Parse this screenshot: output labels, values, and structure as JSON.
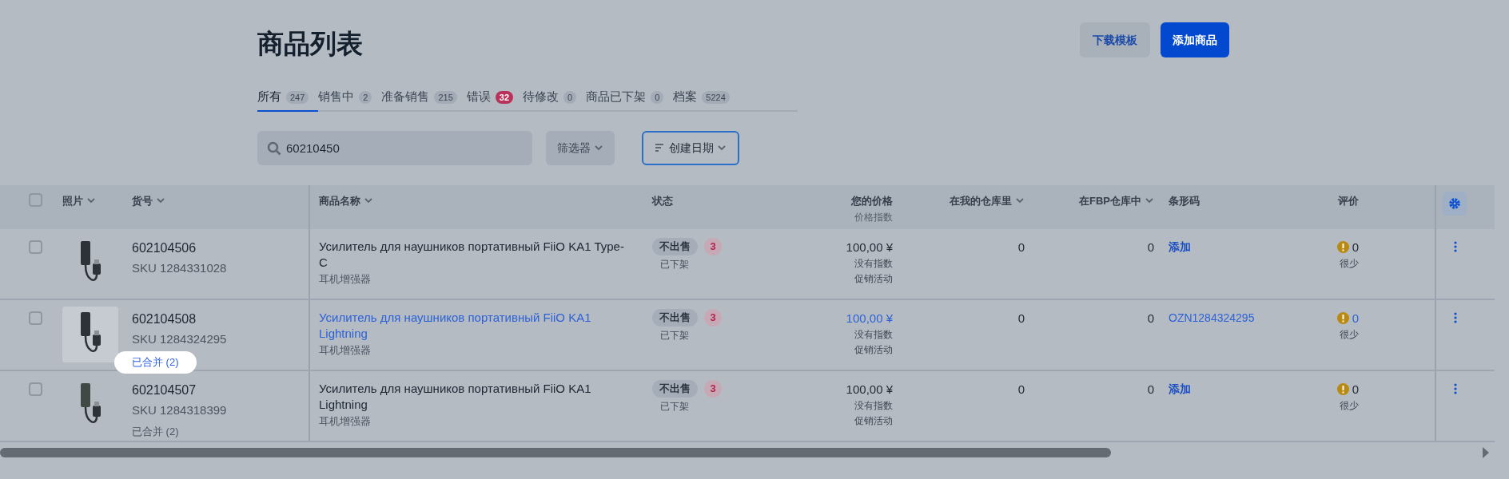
{
  "page": {
    "title": "商品列表"
  },
  "actions": [
    {
      "label": "下载模板",
      "kind": "secondary"
    },
    {
      "label": "添加商品",
      "kind": "primary"
    }
  ],
  "tabs": [
    {
      "label": "所有",
      "count": "247",
      "selected": true,
      "alert": false
    },
    {
      "label": "销售中",
      "count": "2",
      "selected": false,
      "alert": false
    },
    {
      "label": "准备销售",
      "count": "215",
      "selected": false,
      "alert": false
    },
    {
      "label": "错误",
      "count": "32",
      "selected": false,
      "alert": true
    },
    {
      "label": "待修改",
      "count": "0",
      "selected": false,
      "alert": false
    },
    {
      "label": "商品已下架",
      "count": "0",
      "selected": false,
      "alert": false
    },
    {
      "label": "档案",
      "count": "5224",
      "selected": false,
      "alert": false
    }
  ],
  "search": {
    "value": "60210450"
  },
  "filter": {
    "label": "筛选器"
  },
  "sort": {
    "label": "创建日期"
  },
  "table": {
    "all_checked": false,
    "columns": [
      {
        "label": "照片",
        "sortable": true
      },
      {
        "label": "货号",
        "sortable": true
      },
      {
        "label": "商品名称",
        "sortable": true
      },
      {
        "label": "状态",
        "sortable": false
      },
      {
        "label": "您的价格",
        "sub": "价格指数",
        "sortable": false
      },
      {
        "label": "在我的仓库里",
        "sortable": true
      },
      {
        "label": "在FBP仓库中",
        "sortable": true
      },
      {
        "label": "条形码",
        "sortable": false
      },
      {
        "label": "评价",
        "sortable": false
      }
    ],
    "rows": [
      {
        "checked": false,
        "photo_highlighted": false,
        "article": "602104506",
        "sku": "SKU 1284331028",
        "merged": null,
        "name": "Усилитель для наушников портативный FiiO KA1 Type-C",
        "name_link": false,
        "category": "耳机增强器",
        "status": "不出售",
        "errors": "3",
        "status_note": "已下架",
        "price": "100,00 ¥",
        "price_link": false,
        "price_index": "没有指数",
        "promo": "促销活动",
        "my_stock": "0",
        "fbp_stock": "0",
        "barcode": {
          "kind": "add",
          "text": "添加"
        },
        "rating": "0",
        "rating_link": false,
        "rating_note": "很少"
      },
      {
        "checked": false,
        "photo_highlighted": true,
        "article": "602104508",
        "sku": "SKU 1284324295",
        "merged": {
          "label": "已合并 (2)",
          "highlighted": true
        },
        "name": "Усилитель для наушников портативный FiiO KA1 Lightning",
        "name_link": true,
        "category": "耳机增强器",
        "status": "不出售",
        "errors": "3",
        "status_note": "已下架",
        "price": "100,00 ¥",
        "price_link": true,
        "price_index": "没有指数",
        "promo": "促销活动",
        "my_stock": "0",
        "fbp_stock": "0",
        "barcode": {
          "kind": "value",
          "text": "OZN1284324295"
        },
        "rating": "0",
        "rating_link": true,
        "rating_note": "很少"
      },
      {
        "checked": false,
        "photo_highlighted": false,
        "article": "602104507",
        "sku": "SKU 1284318399",
        "merged": {
          "label": "已合并 (2)",
          "highlighted": false
        },
        "name": "Усилитель для наушников портативный FiiO KA1 Lightning",
        "name_link": false,
        "category": "耳机增强器",
        "status": "不出售",
        "errors": "3",
        "status_note": "已下架",
        "price": "100,00 ¥",
        "price_link": false,
        "price_index": "没有指数",
        "promo": "促销活动",
        "my_stock": "0",
        "fbp_stock": "0",
        "barcode": {
          "kind": "add",
          "text": "添加"
        },
        "rating": "0",
        "rating_link": false,
        "rating_note": "很少"
      }
    ]
  }
}
